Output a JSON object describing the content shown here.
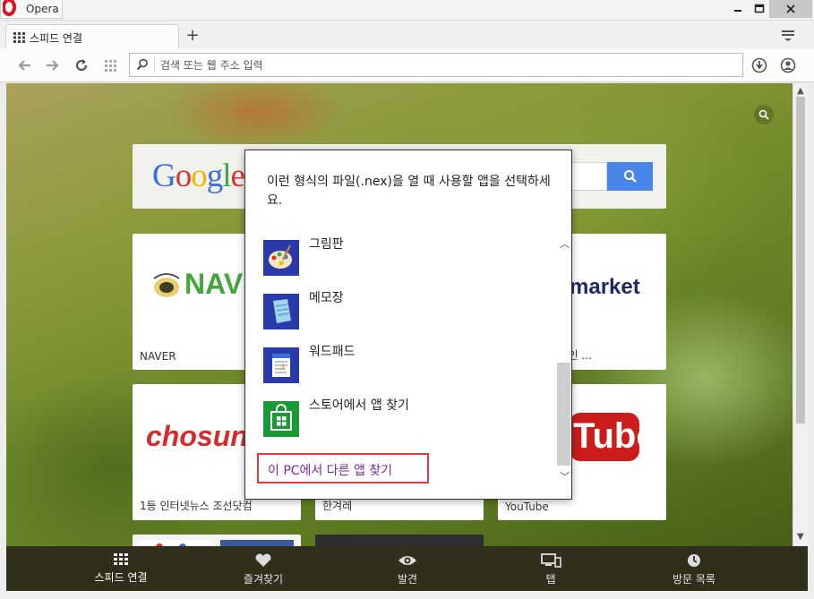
{
  "window": {
    "app_title": "Opera",
    "controls": {
      "minimize_icon": "minimize-icon",
      "maximize_icon": "maximize-icon",
      "close_icon": "close-icon"
    }
  },
  "tabs": [
    {
      "label": "스피드 연결",
      "icon": "speed-dial-grid-icon",
      "active": true
    }
  ],
  "new_tab_label": "+",
  "address_bar": {
    "placeholder": "검색 또는 웹 주소 입력",
    "value": ""
  },
  "speed_dial": {
    "google_logo": "Google",
    "tiles": [
      {
        "label": "NAVER",
        "logo_text": "NAV"
      },
      {
        "label": "1등 인터넷뉴스 조선닷컴",
        "logo_text": "chosun"
      },
      {
        "label": "한국 1등 온라인 ...",
        "logo_text": "market"
      },
      {
        "label": "YouTube",
        "logo_text": "Tube"
      },
      {
        "label": "한겨레",
        "logo_text": ""
      }
    ]
  },
  "bottom_bar": {
    "items": [
      {
        "label": "스피드 연결",
        "icon": "speed-dial-icon"
      },
      {
        "label": "즐겨찾기",
        "icon": "heart-icon"
      },
      {
        "label": "발견",
        "icon": "eye-icon"
      },
      {
        "label": "탭",
        "icon": "devices-icon"
      },
      {
        "label": "방문 목록",
        "icon": "clock-icon"
      }
    ]
  },
  "dialog": {
    "title": "이런 형식의 파일(.nex)을 열 때 사용할 앱을 선택하세요.",
    "apps": [
      {
        "name": "그림판",
        "icon": "paint-icon"
      },
      {
        "name": "메모장",
        "icon": "notepad-icon"
      },
      {
        "name": "워드패드",
        "icon": "wordpad-icon"
      },
      {
        "name": "스토어에서 앱 찾기",
        "icon": "store-icon"
      }
    ],
    "more_link": "이 PC에서 다른 앱 찾기"
  },
  "colors": {
    "accent_blue": "#4a86e8",
    "highlight_red": "#e03a3a",
    "link_purple": "#7a2aa0",
    "bottom_bar": "#2f2f1c"
  }
}
